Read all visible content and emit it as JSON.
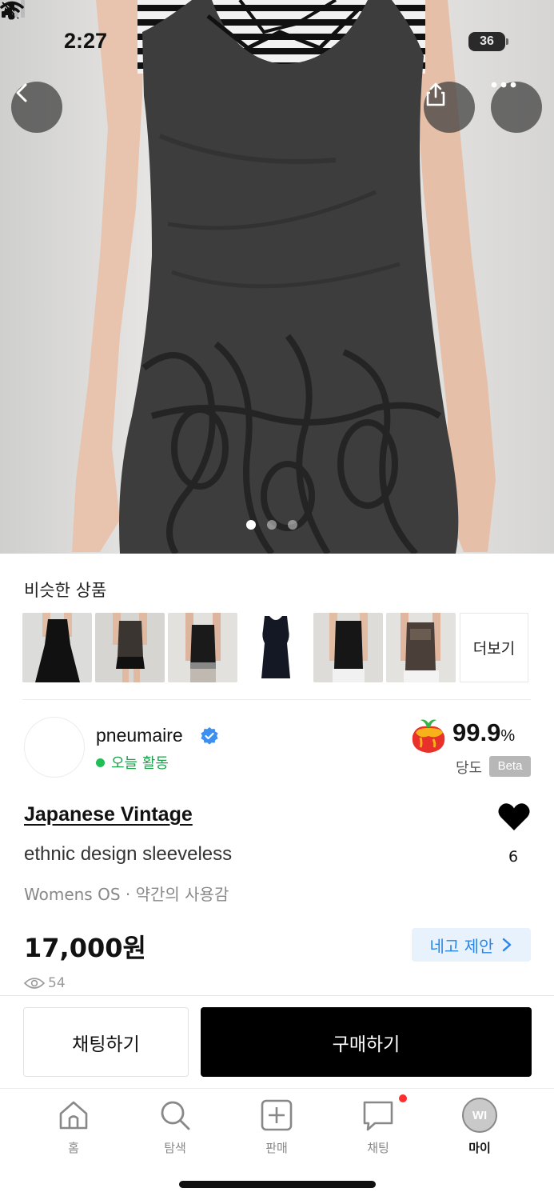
{
  "status_bar": {
    "time": "2:27",
    "battery": "36"
  },
  "gallery": {
    "page_count": 3,
    "current_page": 1
  },
  "similar": {
    "title": "비슷한 상품",
    "more_label": "더보기"
  },
  "seller": {
    "name": "pneumaire",
    "activity": "오늘 활동",
    "score": "99.9",
    "score_unit": "%",
    "score_label": "당도",
    "score_badge": "Beta"
  },
  "product": {
    "brand": "Japanese Vintage",
    "name": "ethnic design sleeveless",
    "meta": "Womens OS · 약간의 사용감",
    "price": "17,000원",
    "negotiate_label": "네고 제안",
    "likes": "6",
    "views": "54"
  },
  "actions": {
    "chat_label": "채팅하기",
    "buy_label": "구매하기"
  },
  "tabbar": {
    "items": [
      {
        "label": "홈",
        "icon": "home-icon"
      },
      {
        "label": "탐색",
        "icon": "search-icon"
      },
      {
        "label": "판매",
        "icon": "plus-square-icon"
      },
      {
        "label": "채팅",
        "icon": "chat-bubble-icon"
      },
      {
        "label": "마이",
        "icon": "profile-icon",
        "avatar_text": "WI"
      }
    ]
  },
  "colors": {
    "brand_black": "#000000",
    "nego_blue": "#2a86e8",
    "active_green": "#1fbf55",
    "badge_red": "#ff2e2e"
  }
}
